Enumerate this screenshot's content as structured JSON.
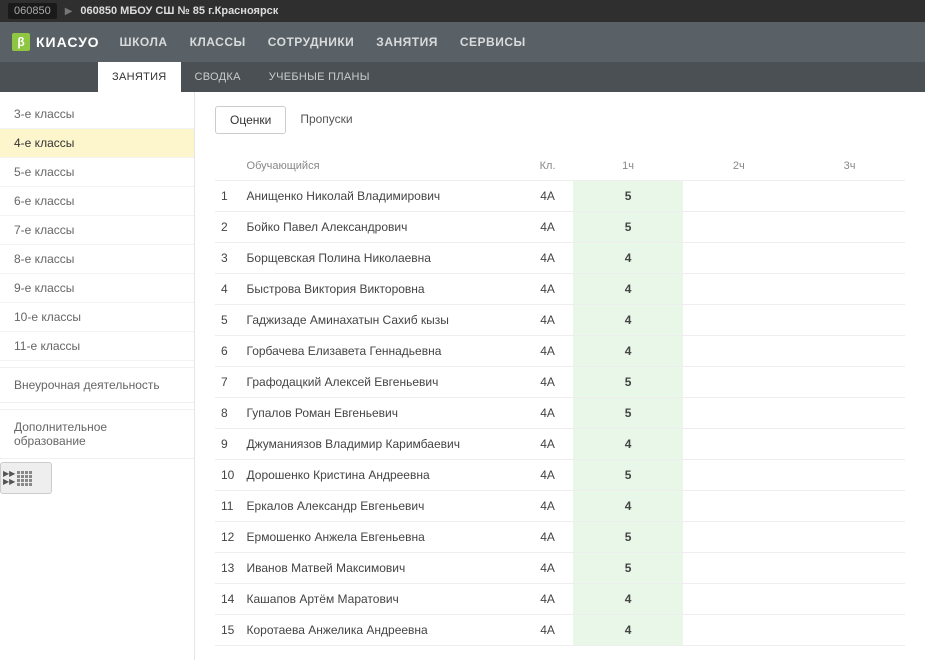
{
  "breadcrumb": {
    "code": "060850",
    "title": "060850 МБОУ СШ № 85 г.Красноярск"
  },
  "logo": {
    "badge": "β",
    "text": "КИАСУО"
  },
  "mainNav": [
    "ШКОЛА",
    "КЛАССЫ",
    "СОТРУДНИКИ",
    "ЗАНЯТИЯ",
    "СЕРВИСЫ"
  ],
  "subNav": {
    "items": [
      "ЗАНЯТИЯ",
      "СВОДКА",
      "УЧЕБНЫЕ ПЛАНЫ"
    ],
    "activeIndex": 0
  },
  "sidebar": {
    "classes": [
      "3-е классы",
      "4-е классы",
      "5-е классы",
      "6-е классы",
      "7-е классы",
      "8-е классы",
      "9-е классы",
      "10-е классы",
      "11-е классы"
    ],
    "activeIndex": 1,
    "extra": [
      "Внеурочная деятельность",
      "Дополнительное образование"
    ]
  },
  "viewTabs": {
    "items": [
      "Оценки",
      "Пропуски"
    ],
    "activeIndex": 0
  },
  "table": {
    "headers": {
      "student": "Обучающийся",
      "kl": "Кл.",
      "h1": "1ч",
      "h2": "2ч",
      "h3": "3ч"
    },
    "rows": [
      {
        "n": "1",
        "name": "Анищенко Николай Владимирович",
        "kl": "4А",
        "g1": "5"
      },
      {
        "n": "2",
        "name": "Бойко Павел Александрович",
        "kl": "4А",
        "g1": "5"
      },
      {
        "n": "3",
        "name": "Борщевская Полина Николаевна",
        "kl": "4А",
        "g1": "4"
      },
      {
        "n": "4",
        "name": "Быстрова Виктория Викторовна",
        "kl": "4А",
        "g1": "4"
      },
      {
        "n": "5",
        "name": "Гаджизаде Аминахатын Сахиб кызы",
        "kl": "4А",
        "g1": "4"
      },
      {
        "n": "6",
        "name": "Горбачева Елизавета Геннадьевна",
        "kl": "4А",
        "g1": "4"
      },
      {
        "n": "7",
        "name": "Графодацкий Алексей Евгеньевич",
        "kl": "4А",
        "g1": "5"
      },
      {
        "n": "8",
        "name": "Гупалов Роман Евгеньевич",
        "kl": "4А",
        "g1": "5"
      },
      {
        "n": "9",
        "name": "Джуманиязов Владимир Каримбаевич",
        "kl": "4А",
        "g1": "4"
      },
      {
        "n": "10",
        "name": "Дорошенко Кристина Андреевна",
        "kl": "4А",
        "g1": "5"
      },
      {
        "n": "11",
        "name": "Еркалов Александр Евгеньевич",
        "kl": "4А",
        "g1": "4"
      },
      {
        "n": "12",
        "name": "Ермошенко Анжела Евгеньевна",
        "kl": "4А",
        "g1": "5"
      },
      {
        "n": "13",
        "name": "Иванов Матвей Максимович",
        "kl": "4А",
        "g1": "5"
      },
      {
        "n": "14",
        "name": "Кашапов Артём Маратович",
        "kl": "4А",
        "g1": "4"
      },
      {
        "n": "15",
        "name": "Коротаева Анжелика Андреевна",
        "kl": "4А",
        "g1": "4"
      }
    ]
  }
}
